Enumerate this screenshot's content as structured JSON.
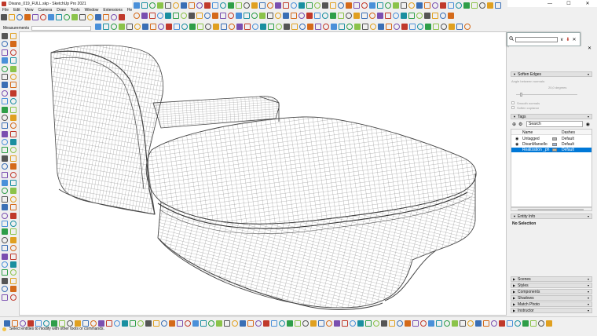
{
  "window": {
    "title": "Divano_019_FULL.skp - SketchUp Pro 2021",
    "controls": [
      "—",
      "☐",
      "✕"
    ]
  },
  "menu": [
    "File",
    "Edit",
    "View",
    "Camera",
    "Draw",
    "Tools",
    "Window",
    "Extensions",
    "Help"
  ],
  "measurements": {
    "label": "Measurements",
    "value": ""
  },
  "search_popup": {
    "buttons": [
      "∨",
      "⬇",
      "✕"
    ]
  },
  "tray": {
    "soften_edges": {
      "title": "Soften Edges",
      "angle_label": "Angle between normals:",
      "angle_value": "20,0 degrees",
      "options": [
        "Smooth normals",
        "Soften coplanar"
      ]
    },
    "tags": {
      "title": "Tags",
      "search_placeholder": "Search",
      "columns": [
        "Name",
        "Dashes"
      ],
      "rows": [
        {
          "name": "Untagged",
          "dashes": "Default",
          "color": "#b0b0b0",
          "selected": false
        },
        {
          "name": "DivanMarsello",
          "dashes": "Default",
          "color": "#9ab4d6",
          "selected": false
        },
        {
          "name": "Realization _ph",
          "dashes": "Default",
          "color": "#c9b48e",
          "selected": true
        }
      ]
    },
    "entity_info": {
      "title": "Entity Info",
      "content": "No Selection"
    },
    "collapsed_panels": [
      "Scenes",
      "Styles",
      "Components",
      "Shadows",
      "Match Photo",
      "Instructor"
    ]
  },
  "status": {
    "text": "Select entities to modify with other tools or commands."
  },
  "colors": {
    "selection": "#0078d7",
    "sketchup_red": "#c0392b",
    "sketchup_green": "#2e9e48"
  }
}
